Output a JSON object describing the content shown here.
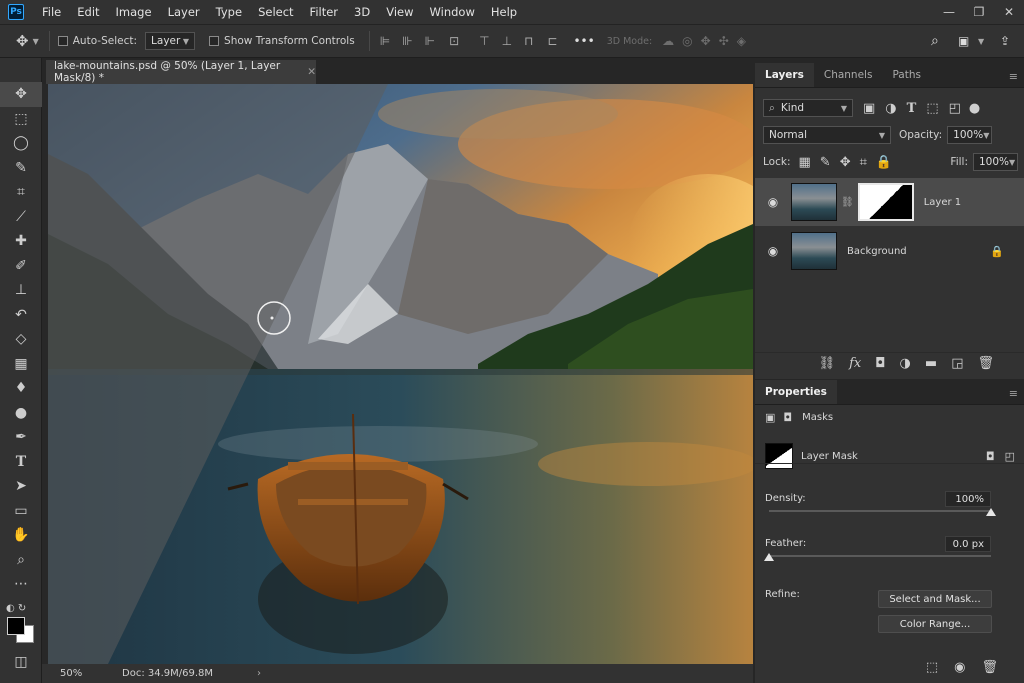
{
  "app": {
    "logo": "Ps"
  },
  "menu": [
    "File",
    "Edit",
    "Image",
    "Layer",
    "Type",
    "Select",
    "Filter",
    "3D",
    "View",
    "Window",
    "Help"
  ],
  "window_controls": {
    "minimize": "—",
    "restore": "❐",
    "close": "✕"
  },
  "options": {
    "auto_select_label": "Auto-Select:",
    "auto_select_value": "Layer",
    "transform_label": "Show Transform Controls",
    "mode_3d_label": "3D Mode:"
  },
  "document": {
    "tab_title": "lake-mountains.psd @ 50% (Layer 1, Layer Mask/8) *",
    "zoom": "50%",
    "doc_info": "Doc: 34.9M/69.8M"
  },
  "layers_panel": {
    "tabs": [
      "Layers",
      "Channels",
      "Paths"
    ],
    "filter_kind": "Kind",
    "blend_mode": "Normal",
    "opacity_label": "Opacity:",
    "opacity_value": "100%",
    "lock_label": "Lock:",
    "fill_label": "Fill:",
    "fill_value": "100%",
    "layers": [
      {
        "name": "Layer 1",
        "has_mask": true,
        "selected": true
      },
      {
        "name": "Background",
        "locked": true,
        "selected": false
      }
    ]
  },
  "properties_panel": {
    "title": "Properties",
    "section": "Masks",
    "mask_label": "Layer Mask",
    "density_label": "Density:",
    "density_value": "100%",
    "density_level": 1.0,
    "feather_label": "Feather:",
    "feather_value": "0.0 px",
    "feather_level": 0.0,
    "refine_label": "Refine:",
    "select_and_mask_label": "Select and Mask...",
    "color_range_label": "Color Range..."
  },
  "colors": {
    "accent": "#31a8ff",
    "panel_bg": "#323232",
    "app_bg": "#262626"
  }
}
